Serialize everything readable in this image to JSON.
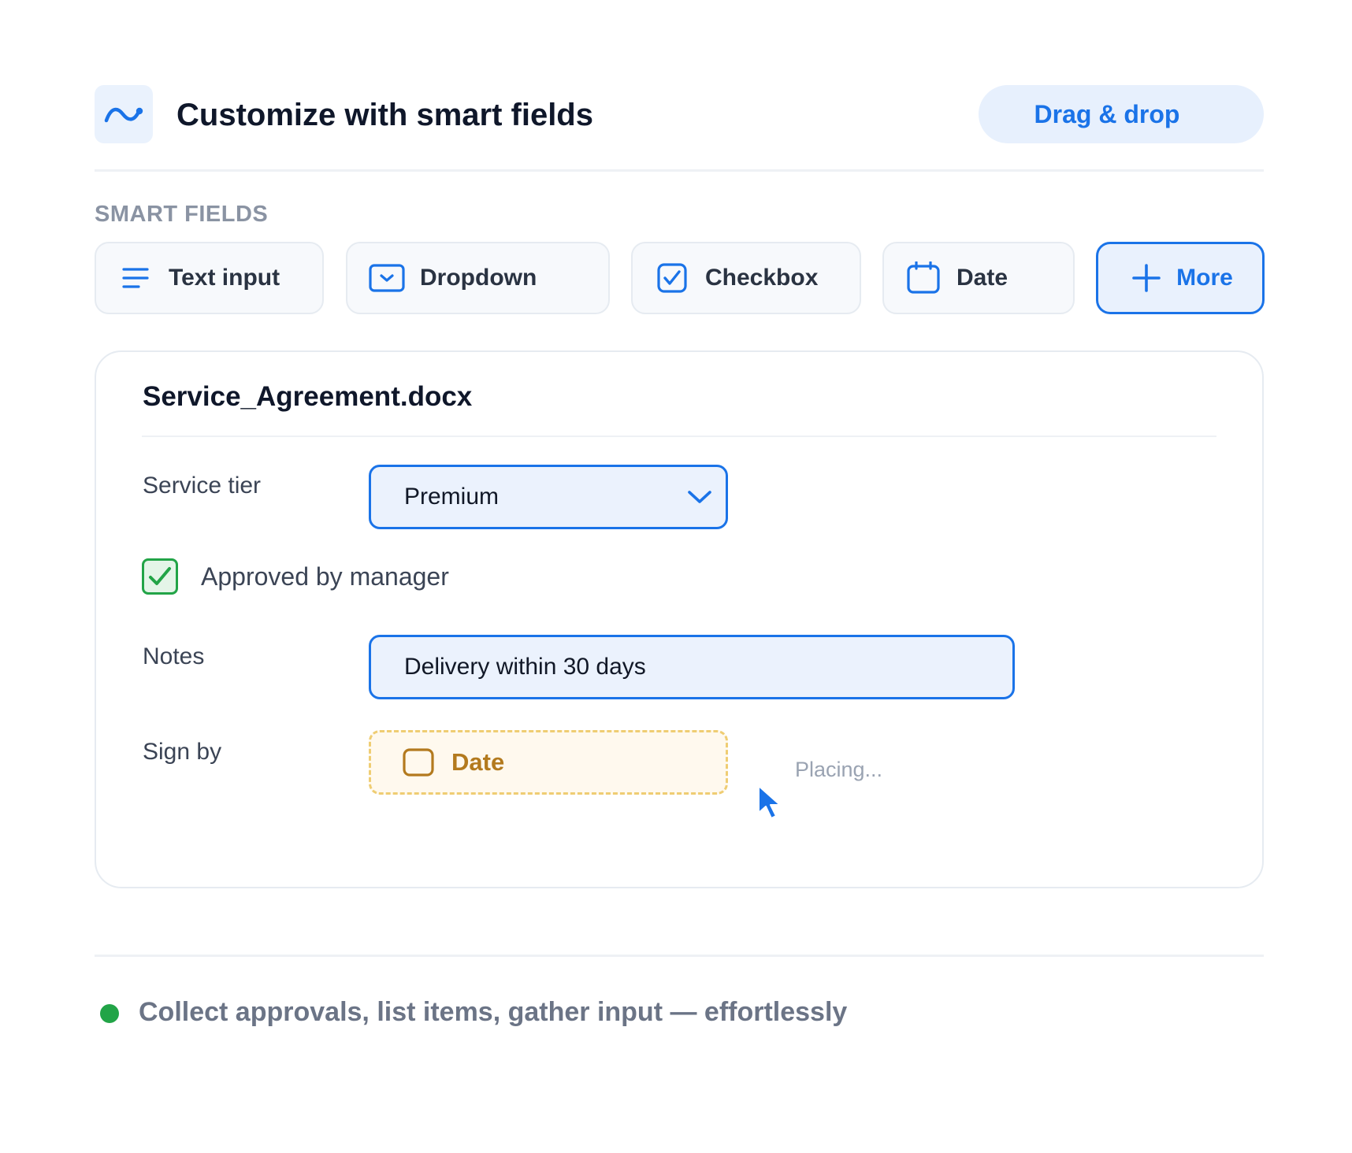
{
  "header": {
    "title": "Customize with smart fields",
    "action_label": "Drag & drop"
  },
  "smart_fields": {
    "section_label": "SMART FIELDS",
    "items": [
      {
        "label": "Text input",
        "icon": "lines-icon"
      },
      {
        "label": "Dropdown",
        "icon": "dropdown-icon"
      },
      {
        "label": "Checkbox",
        "icon": "checkbox-icon"
      },
      {
        "label": "Date",
        "icon": "calendar-icon"
      },
      {
        "label": "More",
        "icon": "plus-icon"
      }
    ]
  },
  "document": {
    "filename": "Service_Agreement.docx",
    "service_tier": {
      "label": "Service tier",
      "value": "Premium"
    },
    "approval": {
      "label": "Approved by manager",
      "checked": true
    },
    "notes": {
      "label": "Notes",
      "value": "Delivery within 30 days"
    },
    "sign_by": {
      "label": "Sign by",
      "placeholder_field": "Date",
      "status": "Placing..."
    }
  },
  "footer": {
    "tagline": "Collect approvals, list items, gather input — effortlessly"
  },
  "colors": {
    "accent": "#1a73e8",
    "success": "#22a447",
    "warning": "#b37a1e",
    "text": "#0f172a",
    "muted": "#8a93a3"
  }
}
